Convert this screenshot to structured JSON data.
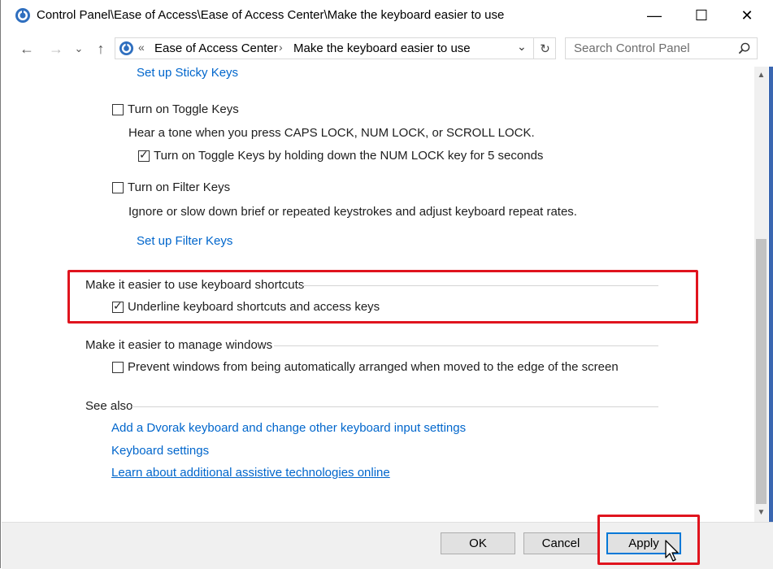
{
  "window": {
    "title": "Control Panel\\Ease of Access\\Ease of Access Center\\Make the keyboard easier to use",
    "title_icon": "control-panel-icon",
    "controls": {
      "minimize": "—",
      "maximize": "☐",
      "close": "✕"
    }
  },
  "nav": {
    "back": "←",
    "forward": "→",
    "recent": "⌄",
    "up": "↑",
    "overflow": "«",
    "breadcrumb": [
      "Ease of Access Center",
      "Make the keyboard easier to use"
    ],
    "crumb_sep": "›",
    "dropdown": "⌄",
    "refresh": "↻"
  },
  "search": {
    "placeholder": "Search Control Panel"
  },
  "content": {
    "sticky_link": "Set up Sticky Keys",
    "toggle": {
      "label": "Turn on Toggle Keys",
      "checked": false,
      "desc": "Hear a tone when you press CAPS LOCK, NUM LOCK, or SCROLL LOCK.",
      "sub_label": "Turn on Toggle Keys by holding down the NUM LOCK key for 5 seconds",
      "sub_checked": true
    },
    "filter": {
      "label": "Turn on Filter Keys",
      "checked": false,
      "desc": "Ignore or slow down brief or repeated keystrokes and adjust keyboard repeat rates.",
      "link": "Set up Filter Keys"
    },
    "shortcuts": {
      "heading": "Make it easier to use keyboard shortcuts",
      "option": "Underline keyboard shortcuts and access keys",
      "checked": true
    },
    "windows": {
      "heading": "Make it easier to manage windows",
      "option": "Prevent windows from being automatically arranged when moved to the edge of the screen",
      "checked": false
    },
    "see_also": {
      "heading": "See also",
      "links": [
        "Add a Dvorak keyboard and change other keyboard input settings",
        "Keyboard settings",
        "Learn about additional assistive technologies online"
      ]
    }
  },
  "scroll": {
    "up": "▲",
    "down": "▼"
  },
  "buttons": {
    "ok": "OK",
    "cancel": "Cancel",
    "apply": "Apply"
  },
  "colors": {
    "highlight": "#e0141e",
    "link": "#0066cc"
  }
}
